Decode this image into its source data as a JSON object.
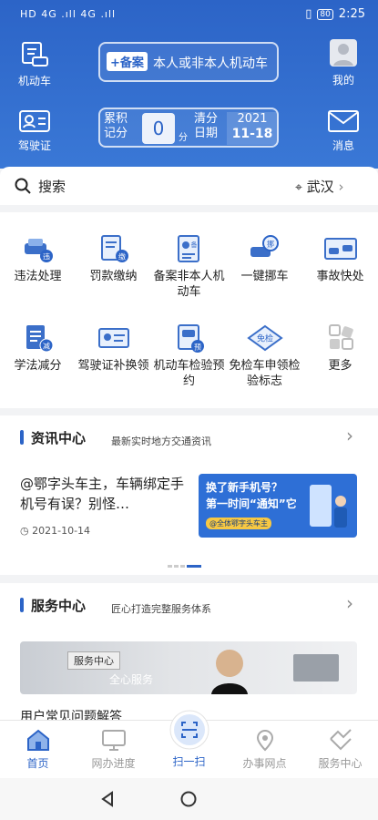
{
  "status_bar": {
    "left": "HD 4G .ıll 4G .ıll",
    "battery": "80",
    "time": "2:25"
  },
  "header": {
    "vehicle_label": "机动车",
    "mine_label": "我的",
    "license_label": "驾驶证",
    "message_label": "消息",
    "record_tag": "+备案",
    "record_text": "本人或非本人机动车",
    "points_label": "累积记分",
    "points_value": "0",
    "points_unit": "分",
    "clear_label": "清分日期",
    "clear_year": "2021",
    "clear_date": "11-18"
  },
  "search": {
    "label": "搜索",
    "city": "武汉"
  },
  "services": [
    "违法处理",
    "罚款缴纳",
    "备案非本人机动车",
    "一键挪车",
    "事故快处",
    "学法减分",
    "驾驶证补换领",
    "机动车检验预约",
    "免检车申领检验标志",
    "更多"
  ],
  "news": {
    "title": "资讯中心",
    "subtitle": "最新实时地方交通资讯",
    "article_title": "@鄂字头车主，车辆绑定手机号有误？别怪…",
    "article_date": "2021-10-14",
    "banner_line1": "换了新手机号？",
    "banner_line2": "第一时间“通知”它",
    "banner_tag": "@全体鄂字头车主"
  },
  "service_center": {
    "title": "服务中心",
    "subtitle": "匠心打造完整服务体系",
    "banner_tag": "服务中心",
    "banner_text": "全心服务",
    "faq": "用户常见问题解答"
  },
  "nav": [
    "首页",
    "网办进度",
    "扫一扫",
    "办事网点",
    "服务中心"
  ]
}
